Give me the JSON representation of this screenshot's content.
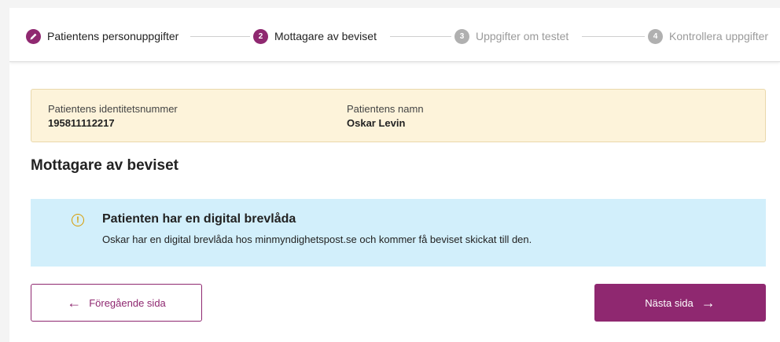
{
  "stepper": {
    "steps": [
      {
        "number": "",
        "label": "Patientens personuppgifter",
        "state": "done",
        "icon": "pencil-icon"
      },
      {
        "number": "2",
        "label": "Mottagare av beviset",
        "state": "active"
      },
      {
        "number": "3",
        "label": "Uppgifter om testet",
        "state": "pending"
      },
      {
        "number": "4",
        "label": "Kontrollera uppgifter",
        "state": "pending"
      }
    ]
  },
  "patient": {
    "id_label": "Patientens identitetsnummer",
    "id_value": "195811112217",
    "name_label": "Patientens namn",
    "name_value": "Oskar Levin"
  },
  "section": {
    "title": "Mottagare av beviset"
  },
  "info": {
    "icon": "info-icon",
    "icon_glyph": "!",
    "title": "Patienten har en digital brevlåda",
    "text": "Oskar har en digital brevlåda hos minmyndighetspost.se och kommer få beviset skickat till den."
  },
  "buttons": {
    "prev_label": "Föregående sida",
    "prev_icon": "arrow-left-icon",
    "next_label": "Nästa sida",
    "next_icon": "arrow-right-icon"
  },
  "colors": {
    "accent": "#8f2870",
    "patient_bar_bg": "#fdf3da",
    "info_bg": "#d2effb",
    "info_icon": "#d79b00",
    "pending": "#b0b0b0"
  }
}
